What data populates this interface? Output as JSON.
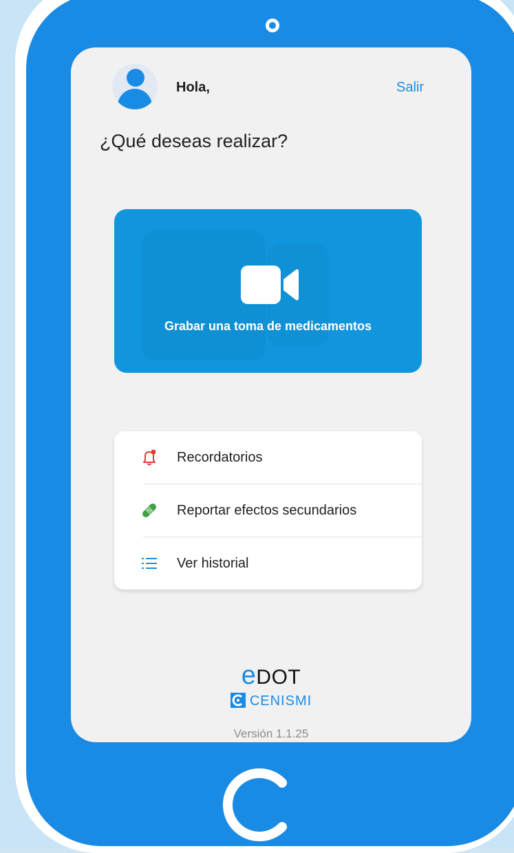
{
  "header": {
    "greeting": "Hola,",
    "logout_label": "Salir"
  },
  "question": "¿Qué deseas realizar?",
  "record_card": {
    "label": "Grabar una toma de medicamentos",
    "icon": "video-camera-icon"
  },
  "menu": {
    "items": [
      {
        "label": "Recordatorios",
        "icon": "bell-alert-icon"
      },
      {
        "label": "Reportar efectos secundarios",
        "icon": "bandage-icon"
      },
      {
        "label": "Ver historial",
        "icon": "list-icon"
      }
    ]
  },
  "brand": {
    "e": "e",
    "name": "DOT",
    "org": "CENISMI",
    "version": "Versión 1.1.25"
  },
  "colors": {
    "accent": "#1a8be4",
    "card": "#1196dd",
    "alert": "#e53935",
    "green": "#43a047"
  }
}
